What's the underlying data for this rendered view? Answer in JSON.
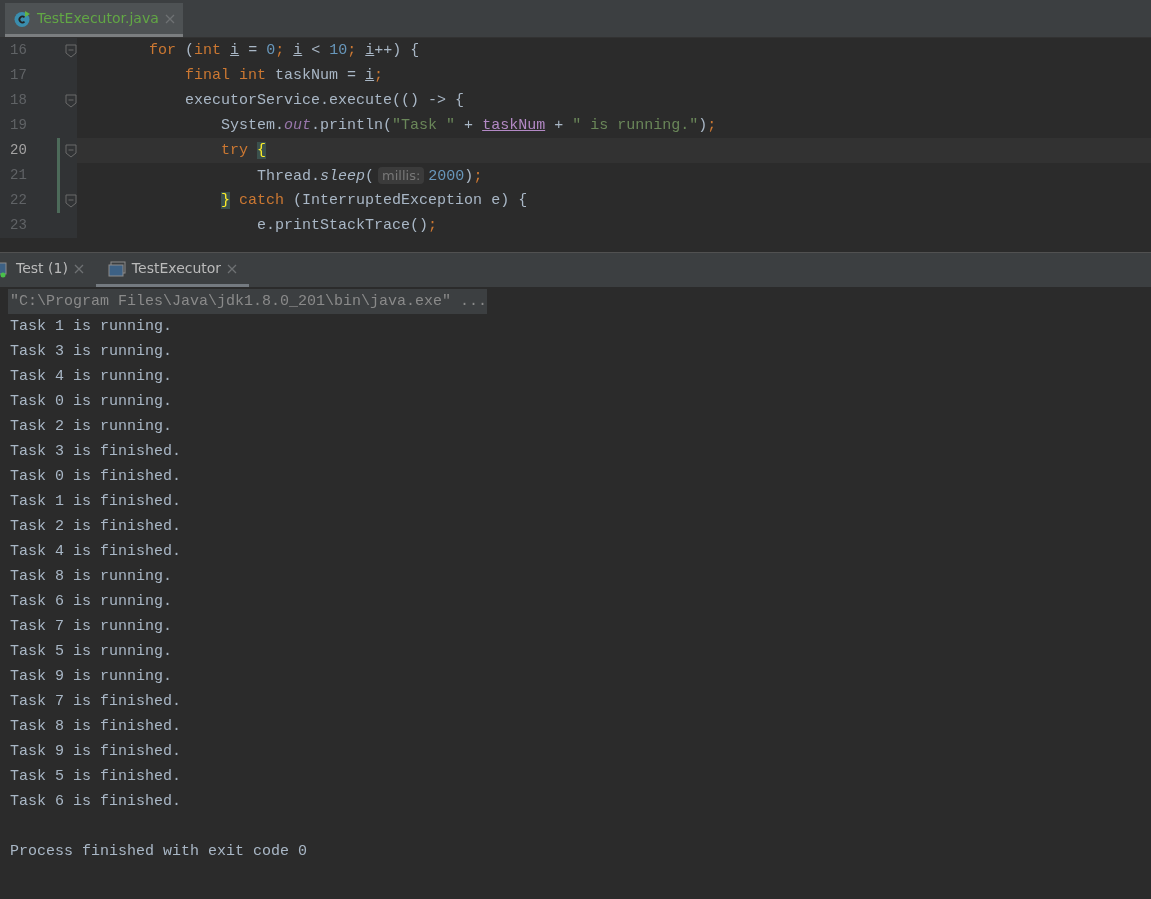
{
  "editor_tabs": [
    {
      "label": "TestExecutor.java",
      "selected": true
    }
  ],
  "code_lines": [
    {
      "number": "16",
      "current": false,
      "changed": false,
      "fold": true,
      "tokens": [
        {
          "text": "        for",
          "kind": "kw"
        },
        {
          "text": " (",
          "kind": "plain"
        },
        {
          "text": "int",
          "kind": "kw"
        },
        {
          "text": " i",
          "kind": "var"
        },
        {
          "text": " = ",
          "kind": "plain"
        },
        {
          "text": "0",
          "kind": "num"
        },
        {
          "text": ";",
          "kind": "kw"
        },
        {
          "text": " i",
          "kind": "var"
        },
        {
          "text": " < ",
          "kind": "plain"
        },
        {
          "text": "10",
          "kind": "num"
        },
        {
          "text": ";",
          "kind": "kw"
        },
        {
          "text": " i",
          "kind": "var"
        },
        {
          "text": "++) {",
          "kind": "plain"
        }
      ]
    },
    {
      "number": "17",
      "current": false,
      "changed": false,
      "fold": false,
      "tokens": [
        {
          "text": "            final int",
          "kind": "kw"
        },
        {
          "text": " taskNum = ",
          "kind": "plain"
        },
        {
          "text": "i",
          "kind": "var"
        },
        {
          "text": ";",
          "kind": "kw"
        }
      ]
    },
    {
      "number": "18",
      "current": false,
      "changed": false,
      "fold": true,
      "tokens": [
        {
          "text": "            executorService.execute(() -> {",
          "kind": "plain"
        }
      ]
    },
    {
      "number": "19",
      "current": false,
      "changed": false,
      "fold": false,
      "tokens": [
        {
          "text": "                System.",
          "kind": "plain"
        },
        {
          "text": "out",
          "kind": "field"
        },
        {
          "text": ".println(",
          "kind": "plain"
        },
        {
          "text": "\"Task \"",
          "kind": "str"
        },
        {
          "text": " + ",
          "kind": "plain"
        },
        {
          "text": "taskNum",
          "kind": "captured"
        },
        {
          "text": " + ",
          "kind": "plain"
        },
        {
          "text": "\" is running.\"",
          "kind": "str"
        },
        {
          "text": ")",
          "kind": "plain"
        },
        {
          "text": ";",
          "kind": "kw"
        }
      ]
    },
    {
      "number": "20",
      "current": true,
      "changed": true,
      "fold": true,
      "tokens": [
        {
          "text": "                try",
          "kind": "kw"
        },
        {
          "text": " {",
          "kind": "brace"
        }
      ]
    },
    {
      "number": "21",
      "current": false,
      "changed": true,
      "fold": false,
      "tokens": [
        {
          "text": "                    Thread.",
          "kind": "plain"
        },
        {
          "text": "sleep",
          "kind": "static"
        },
        {
          "text": "(",
          "kind": "plain"
        },
        {
          "text": "millis:",
          "kind": "hint"
        },
        {
          "text": "2000",
          "kind": "num"
        },
        {
          "text": ")",
          "kind": "plain"
        },
        {
          "text": ";",
          "kind": "kw"
        }
      ]
    },
    {
      "number": "22",
      "current": false,
      "changed": true,
      "fold": true,
      "tokens": [
        {
          "text": "                }",
          "kind": "brace"
        },
        {
          "text": " catch",
          "kind": "kw"
        },
        {
          "text": " (InterruptedException e) {",
          "kind": "plain"
        }
      ]
    },
    {
      "number": "23",
      "current": false,
      "changed": false,
      "fold": false,
      "tokens": [
        {
          "text": "                    e.printStackTrace()",
          "kind": "plain"
        },
        {
          "text": ";",
          "kind": "kw"
        }
      ]
    }
  ],
  "console_tabs": [
    {
      "label": "Test (1)",
      "selected": false
    },
    {
      "label": "TestExecutor",
      "selected": true
    }
  ],
  "console": {
    "command": "\"C:\\Program Files\\Java\\jdk1.8.0_201\\bin\\java.exe\" ...",
    "lines": [
      "Task 1 is running.",
      "Task 3 is running.",
      "Task 4 is running.",
      "Task 0 is running.",
      "Task 2 is running.",
      "Task 3 is finished.",
      "Task 0 is finished.",
      "Task 1 is finished.",
      "Task 2 is finished.",
      "Task 4 is finished.",
      "Task 8 is running.",
      "Task 6 is running.",
      "Task 7 is running.",
      "Task 5 is running.",
      "Task 9 is running.",
      "Task 7 is finished.",
      "Task 8 is finished.",
      "Task 9 is finished.",
      "Task 5 is finished.",
      "Task 6 is finished."
    ],
    "exit_message": "Process finished with exit code 0"
  }
}
